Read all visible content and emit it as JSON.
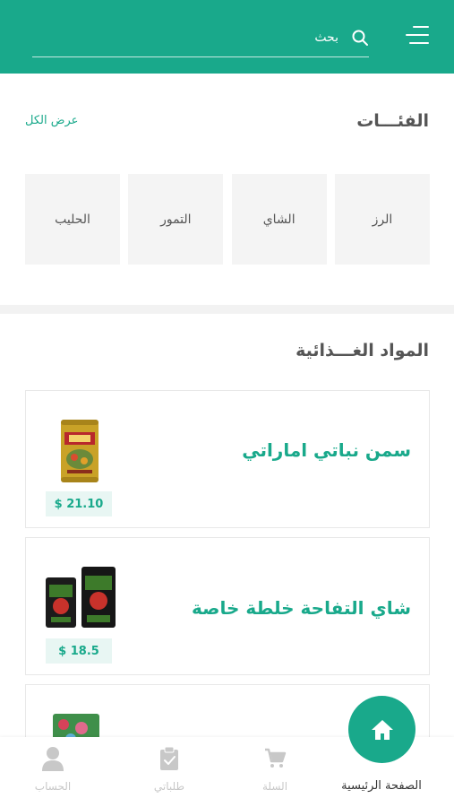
{
  "search": {
    "placeholder": "بحث"
  },
  "categories": {
    "title": "الفئـــات",
    "view_all": "عرض الكل",
    "items": [
      "الرز",
      "الشاي",
      "التمور",
      "الحليب"
    ]
  },
  "food_items": {
    "title": "المواد الغـــذائية",
    "products": [
      {
        "name": "سمن نباتي اماراتي",
        "price": "$ 21.10"
      },
      {
        "name": "شاي التفاحة خلطة خاصة",
        "price": "$ 18.5"
      },
      {
        "name": "",
        "price": ""
      }
    ]
  },
  "bottom_nav": {
    "home": "الصفحة الرئيسية",
    "cart": "السلة",
    "orders": "طلباتي",
    "account": "الحساب"
  },
  "colors": {
    "accent": "#19a98b",
    "inactive": "#c8c8c8",
    "tile_bg": "#f4f4f4"
  }
}
